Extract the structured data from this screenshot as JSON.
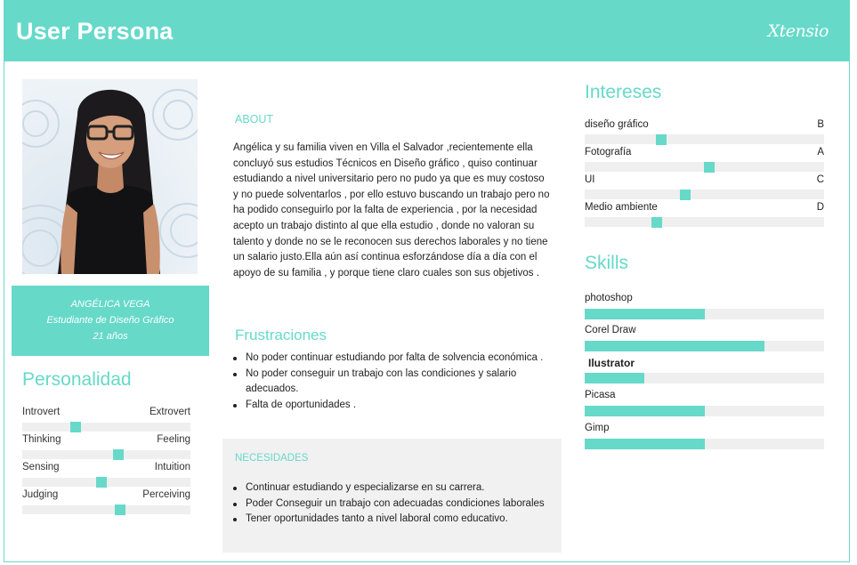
{
  "header": {
    "title": "User Persona",
    "logo": "Xtensio"
  },
  "profile": {
    "name": "ANGÉLICA  VEGA",
    "role": "Estudiante de Diseño Gráfico",
    "age": "21 años"
  },
  "personality": {
    "title": "Personalidad",
    "traits": [
      {
        "left": "Introvert",
        "right": "Extrovert",
        "level": 0.32
      },
      {
        "left": "Thinking",
        "right": "Feeling",
        "level": 0.57
      },
      {
        "left": "Sensing",
        "right": "Intuition",
        "level": 0.47
      },
      {
        "left": "Judging",
        "right": "Perceiving",
        "level": 0.58
      }
    ]
  },
  "about": {
    "title": "ABOUT",
    "text": "Angélica  y su familia viven en Villa el Salvador ,recientemente ella concluyó sus estudios Técnicos en Diseño gráfico  ,  quiso continuar estudiando a nivel universitario pero no pudo ya que es muy costoso  y no puede solventarlos  , por  ello estuvo buscando un trabajo  pero no ha podido  conseguirlo por la falta de experiencia  , por la necesidad acepto un trabajo  distinto al que ella estudio , donde no valoran su talento y donde no se le reconocen sus derechos laborales y no  tiene un salario justo.Ella aún así continua esforzándose día a día con el apoyo de su familia , y porque tiene claro cuales son sus objetivos ."
  },
  "frustrations": {
    "title": "Frustraciones",
    "items": [
      "No poder continuar estudiando por falta de solvencia económica  .",
      "No poder conseguir un trabajo con las condiciones y salario adecuados.",
      "Falta de oportunidades ."
    ]
  },
  "needs": {
    "title": "NECESIDADES",
    "items": [
      "Continuar estudiando  y especializarse  en su carrera.",
      "Poder Conseguir un trabajo con adecuadas condiciones laborales",
      "Tener oportunidades  tanto a nivel laboral  como  educativo."
    ]
  },
  "interests": {
    "title": "Intereses",
    "items": [
      {
        "label": "diseño gráfico",
        "tag": "B",
        "level": 0.32
      },
      {
        "label": "Fotografía",
        "tag": "A",
        "level": 0.52
      },
      {
        "label": "UI",
        "tag": "C",
        "level": 0.42
      },
      {
        "label": "Medio ambiente",
        "tag": "D",
        "level": 0.3
      }
    ]
  },
  "skills": {
    "title": "Skills",
    "items": [
      {
        "name": "photoshop",
        "level": 0.5,
        "bold": false
      },
      {
        "name": "Corel Draw",
        "level": 0.75,
        "bold": false
      },
      {
        "name": "Ilustrator",
        "level": 0.25,
        "bold": true
      },
      {
        "name": "Picasa",
        "level": 0.5,
        "bold": false
      },
      {
        "name": "Gimp",
        "level": 0.5,
        "bold": false
      }
    ]
  },
  "colors": {
    "accent": "#66d9c9",
    "track": "#efefef",
    "panel": "#f1f1f1"
  }
}
